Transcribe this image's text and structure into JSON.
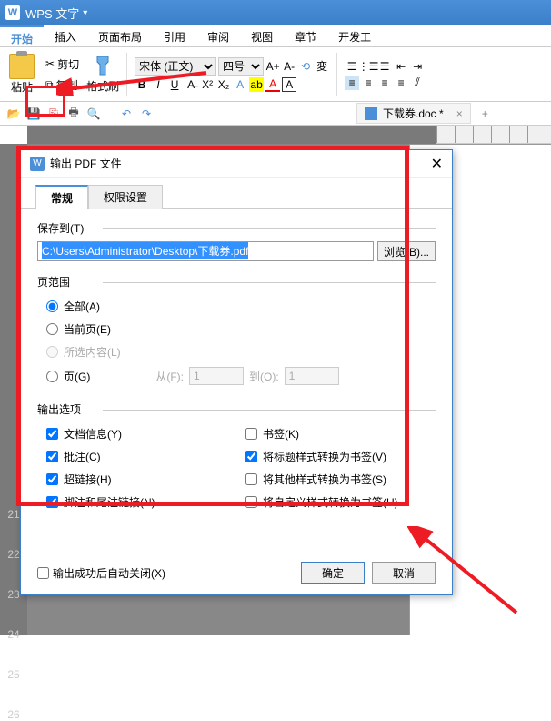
{
  "app": {
    "name": "WPS 文字",
    "logo": "W"
  },
  "menu": {
    "tabs": [
      "开始",
      "插入",
      "页面布局",
      "引用",
      "审阅",
      "视图",
      "章节",
      "开发工"
    ]
  },
  "ribbon": {
    "paste": "粘贴",
    "cut": "剪切",
    "copy": "复制",
    "format_brush": "格式刷",
    "font_family": "宋体 (正文)",
    "font_size": "四号"
  },
  "doc_tab": {
    "name": "下载券.doc *"
  },
  "dialog": {
    "title": "输出 PDF 文件",
    "tabs": {
      "general": "常规",
      "permissions": "权限设置"
    },
    "save_to_label": "保存到(T)",
    "save_path": "C:\\Users\\Administrator\\Desktop\\下载券.pdf",
    "browse": "浏览(B)...",
    "range_label": "页范围",
    "range": {
      "all": "全部(A)",
      "current": "当前页(E)",
      "selection": "所选内容(L)",
      "pages": "页(G)",
      "from": "从(F):",
      "from_val": "1",
      "to": "到(O):",
      "to_val": "1"
    },
    "options_label": "输出选项",
    "opts_left": {
      "doc_info": "文档信息(Y)",
      "comments": "批注(C)",
      "hyperlinks": "超链接(H)",
      "footnotes": "脚注和尾注链接(N)"
    },
    "opts_right": {
      "bookmarks": "书签(K)",
      "heading_to_bm": "将标题样式转换为书签(V)",
      "other_to_bm": "将其他样式转换为书签(S)",
      "custom_to_bm": "将自定义样式转换为书签(U)"
    },
    "auto_close": "输出成功后自动关闭(X)",
    "ok": "确定",
    "cancel": "取消"
  },
  "ruler_marks": [
    "21",
    "22",
    "23",
    "24",
    "25",
    "26"
  ]
}
